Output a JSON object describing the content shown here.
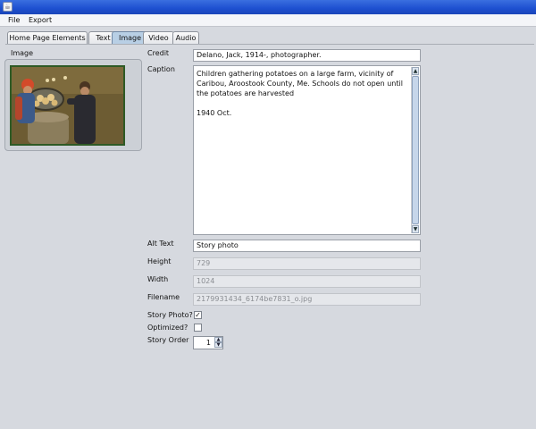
{
  "window": {
    "icon": "java-app-icon"
  },
  "menubar": {
    "items": [
      "File",
      "Export"
    ]
  },
  "tabs": [
    {
      "label": "Home Page Elements",
      "selected": false
    },
    {
      "label": "Text",
      "selected": false
    },
    {
      "label": "Image",
      "selected": true
    },
    {
      "label": "Video",
      "selected": false
    },
    {
      "label": "Audio",
      "selected": false
    }
  ],
  "image_panel": {
    "title": "Image",
    "thumbnail": "children-gathering-potatoes-photo"
  },
  "form": {
    "credit": {
      "label": "Credit",
      "value": "Delano, Jack, 1914-, photographer."
    },
    "caption": {
      "label": "Caption",
      "value": "Children gathering potatoes on a large farm, vicinity of Caribou, Aroostook County, Me. Schools do not open until the potatoes are harvested\n\n1940 Oct."
    },
    "alt_text": {
      "label": "Alt Text",
      "value": "Story photo"
    },
    "height": {
      "label": "Height",
      "value": "729"
    },
    "width": {
      "label": "Width",
      "value": "1024"
    },
    "filename": {
      "label": "Filename",
      "value": "2179931434_6174be7831_o.jpg"
    },
    "story_photo": {
      "label": "Story Photo?",
      "checked": true
    },
    "optimized": {
      "label": "Optimized?",
      "checked": false
    },
    "story_order": {
      "label": "Story Order",
      "value": "1"
    }
  },
  "colors": {
    "titlebar": "#1d4fd0",
    "selected_tab": "#b8cfe5",
    "background": "#d6d9df"
  }
}
